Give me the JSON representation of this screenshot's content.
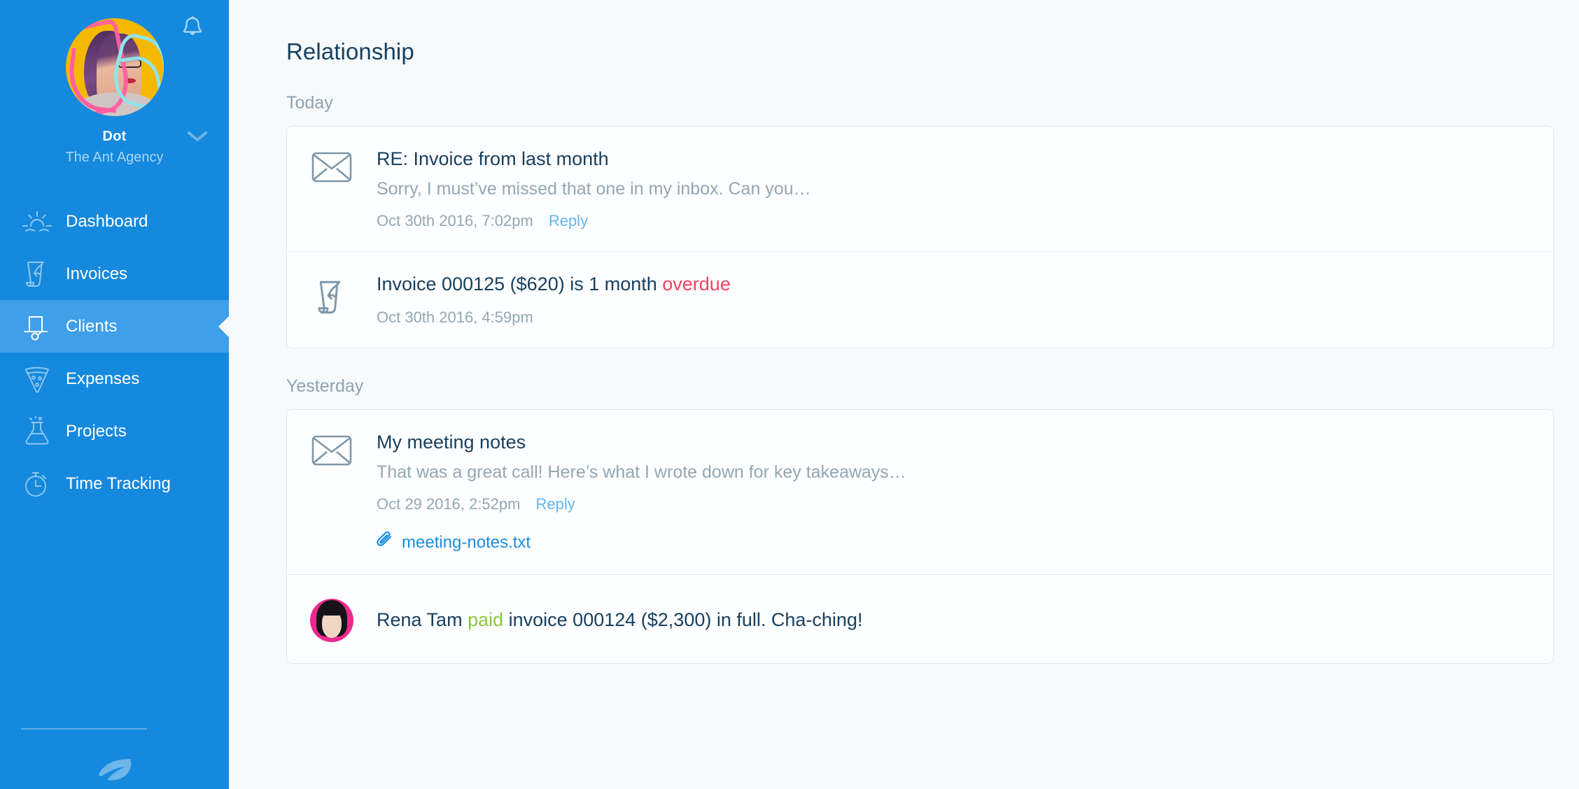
{
  "sidebar": {
    "notification_icon": "bell-icon",
    "profile": {
      "name": "Dot",
      "organization": "The Ant Agency",
      "caret_icon": "chevron-down-icon",
      "avatar": "user-avatar"
    },
    "items": [
      {
        "label": "Dashboard",
        "icon": "sunrise-icon",
        "active": false
      },
      {
        "label": "Invoices",
        "icon": "scroll-quill-icon",
        "active": false
      },
      {
        "label": "Clients",
        "icon": "top-hat-icon",
        "active": true
      },
      {
        "label": "Expenses",
        "icon": "pizza-slice-icon",
        "active": false
      },
      {
        "label": "Projects",
        "icon": "flask-icon",
        "active": false
      },
      {
        "label": "Time Tracking",
        "icon": "stopwatch-icon",
        "active": false
      }
    ],
    "footer_logo": "leaf-logo"
  },
  "main": {
    "title": "Relationship",
    "sections": [
      {
        "label": "Today",
        "rows": [
          {
            "kind": "email",
            "icon": "envelope-icon",
            "title": "RE: Invoice from last month",
            "preview": "Sorry, I must’ve missed that one in my inbox. Can you…",
            "date": "Oct 30th 2016, 7:02pm",
            "reply_label": "Reply"
          },
          {
            "kind": "invoice",
            "icon": "scroll-quill-icon",
            "title_pre": "Invoice 000125 ($620) is 1 month ",
            "title_highlight": "overdue",
            "title_post": "",
            "date": "Oct 30th 2016, 4:59pm"
          }
        ]
      },
      {
        "label": "Yesterday",
        "rows": [
          {
            "kind": "email",
            "icon": "envelope-icon",
            "title": "My meeting notes",
            "preview": "That was a great call! Here’s what I wrote down for key takeaways…",
            "date": "Oct 29 2016, 2:52pm",
            "reply_label": "Reply",
            "attachment": {
              "icon": "paperclip-icon",
              "name": "meeting-notes.txt"
            }
          },
          {
            "kind": "person",
            "icon": "contact-avatar",
            "title_pre": "Rena Tam ",
            "title_highlight": "paid",
            "title_post": " invoice 000124 ($2,300) in full. Cha-ching!"
          }
        ]
      }
    ]
  },
  "colors": {
    "sidebar": "#1589dd",
    "sidebar_active": "#3f9fe8",
    "page_bg": "#f7fafc",
    "title": "#17405f",
    "muted": "#93a7b4",
    "link": "#62b6f0",
    "attachment_link": "#1a8ee0",
    "overdue": "#f9405e",
    "paid": "#8cc63f"
  }
}
